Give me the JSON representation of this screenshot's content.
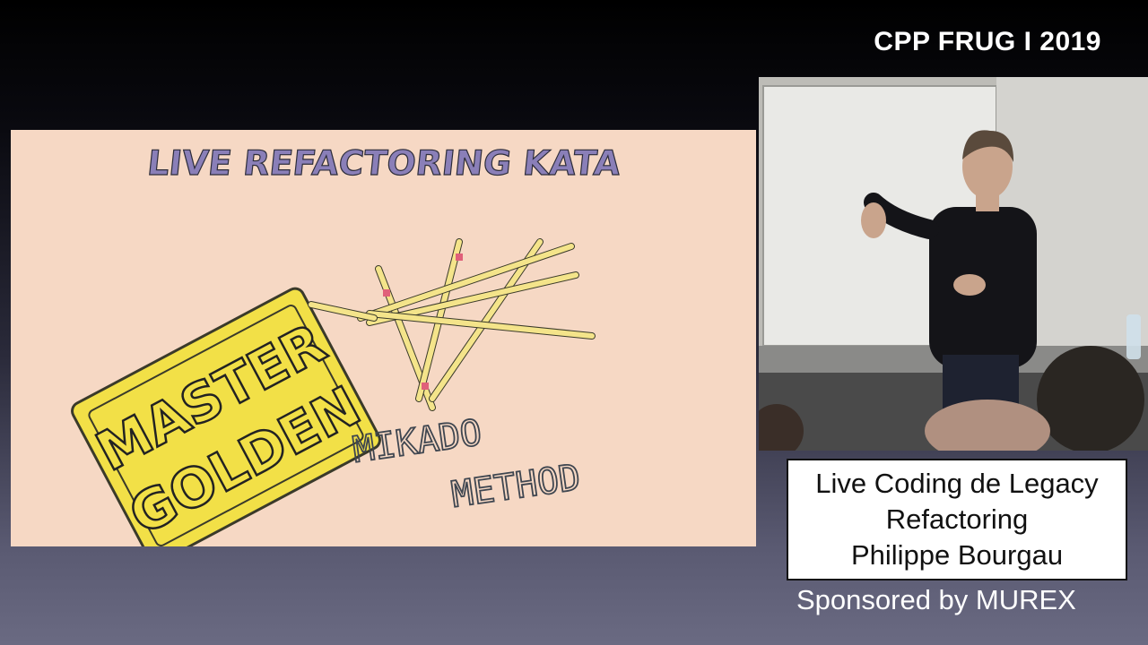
{
  "event": {
    "label": "CPP FRUG I 2019"
  },
  "slide": {
    "title": "LIVE REFACTORING KATA",
    "stamp_line1": "MASTER",
    "stamp_line2": "GOLDEN",
    "method_line1": "MIKADO",
    "method_line2": "METHOD",
    "colors": {
      "background": "#f6d8c4",
      "title": "#8a7fb8",
      "stamp": "#f2e047",
      "sticks": "#f4e48a"
    }
  },
  "caption": {
    "line1": "Live Coding de Legacy",
    "line2": "Refactoring",
    "line3": "Philippe Bourgau"
  },
  "sponsor": {
    "text": "Sponsored by MUREX"
  }
}
